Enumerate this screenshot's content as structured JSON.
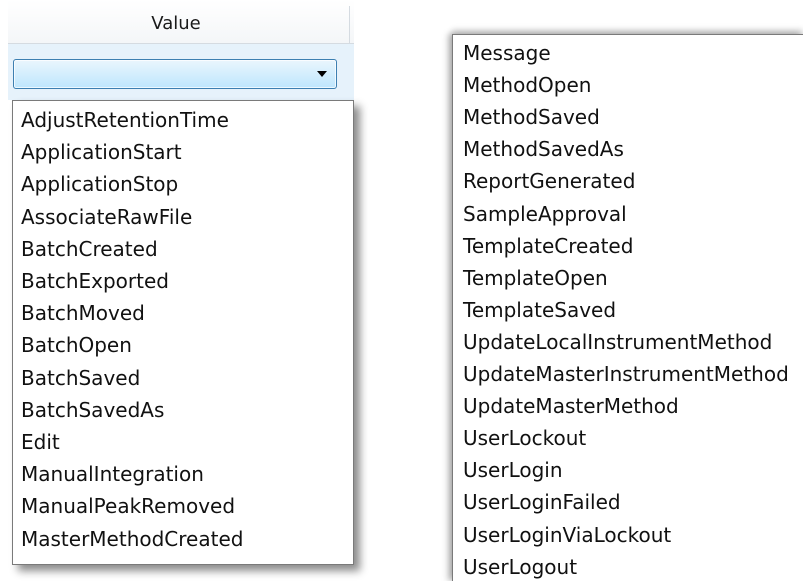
{
  "grid": {
    "column_header": "Value",
    "filter_combo": {
      "value": "",
      "arrow_icon": "chevron-down-icon"
    }
  },
  "dropdown_left": {
    "items": [
      "AdjustRetentionTime",
      "ApplicationStart",
      "ApplicationStop",
      "AssociateRawFile",
      "BatchCreated",
      "BatchExported",
      "BatchMoved",
      "BatchOpen",
      "BatchSaved",
      "BatchSavedAs",
      "Edit",
      "ManualIntegration",
      "ManualPeakRemoved",
      "MasterMethodCreated"
    ]
  },
  "dropdown_right": {
    "items": [
      "Message",
      "MethodOpen",
      "MethodSaved",
      "MethodSavedAs",
      "ReportGenerated",
      "SampleApproval",
      "TemplateCreated",
      "TemplateOpen",
      "TemplateSaved",
      "UpdateLocalInstrumentMethod",
      "UpdateMasterInstrumentMethod",
      "UpdateMasterMethod",
      "UserLockout",
      "UserLogin",
      "UserLoginFailed",
      "UserLoginViaLockout",
      "UserLogout"
    ]
  },
  "colors": {
    "combo_border": "#3c7fb1",
    "combo_fill_top": "#eaf6fd",
    "combo_fill_bottom": "#bee6fd",
    "filter_row_bg": "#e6f2fb"
  }
}
